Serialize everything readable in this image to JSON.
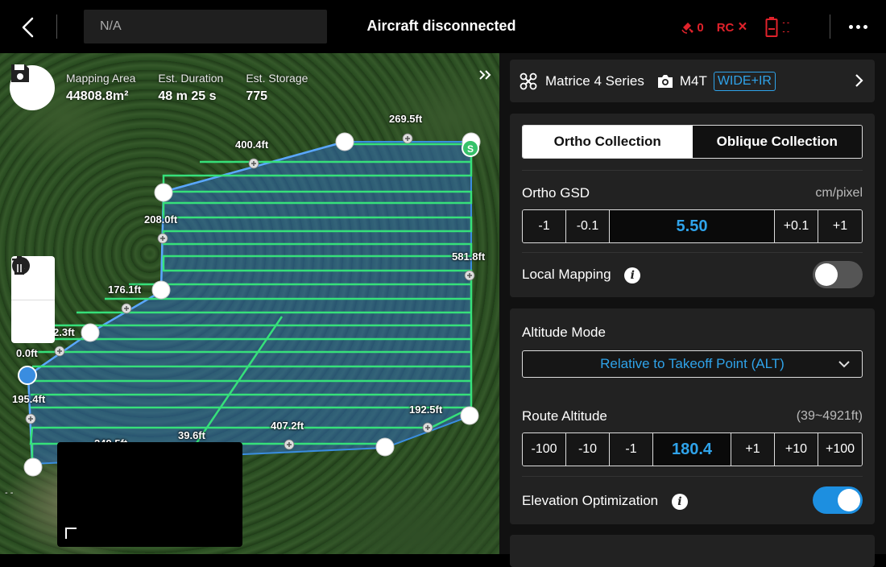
{
  "topbar": {
    "mission_name": "N/A",
    "connection_status": "Aircraft disconnected",
    "signal_count": "0",
    "rc_label": "RC",
    "rc_state": "×",
    "battery_top": "- -",
    "battery_bottom": "- -"
  },
  "map": {
    "summary": {
      "area_label": "Mapping Area",
      "area_value": "44808.8m²",
      "duration_label": "Est. Duration",
      "duration_value": "48 m 25 s",
      "storage_label": "Est. Storage",
      "storage_value": "775"
    },
    "distance_labels": [
      {
        "text": "269.5ft"
      },
      {
        "text": "400.4ft"
      },
      {
        "text": "208.0ft"
      },
      {
        "text": "581.8ft"
      },
      {
        "text": "176.1ft"
      },
      {
        "text": "2.3ft"
      },
      {
        "text": "0.0ft"
      },
      {
        "text": "195.4ft"
      },
      {
        "text": "192.5ft"
      },
      {
        "text": "407.2ft"
      },
      {
        "text": "39.6ft"
      },
      {
        "text": "249.5ft"
      }
    ],
    "start_marker": "S",
    "scale_text": "- -"
  },
  "panel": {
    "aircraft": {
      "model": "Matrice 4 Series",
      "camera": "M4T",
      "lens_badge": "WIDE+IR"
    },
    "collection_tabs": [
      {
        "label": "Ortho Collection",
        "active": true
      },
      {
        "label": "Oblique Collection",
        "active": false
      }
    ],
    "gsd": {
      "label": "Ortho GSD",
      "unit": "cm/pixel",
      "dec_large": "-1",
      "dec_small": "-0.1",
      "value": "5.50",
      "inc_small": "+0.1",
      "inc_large": "+1"
    },
    "local_mapping": {
      "label": "Local Mapping",
      "enabled": false
    },
    "altitude_mode": {
      "label": "Altitude Mode",
      "selected": "Relative to Takeoff Point (ALT)"
    },
    "route_altitude": {
      "label": "Route Altitude",
      "range": "(39~4921ft)",
      "dec_100": "-100",
      "dec_10": "-10",
      "dec_1": "-1",
      "value": "180.4",
      "inc_1": "+1",
      "inc_10": "+10",
      "inc_100": "+100"
    },
    "elevation_optimization": {
      "label": "Elevation Optimization",
      "enabled": true
    }
  },
  "colors": {
    "accent_blue": "#2fa3ea",
    "toggle_on": "#1d8fe0",
    "alert_red": "#e0222b",
    "route_green": "#36e07a",
    "area_blue": "#3a8de0"
  }
}
